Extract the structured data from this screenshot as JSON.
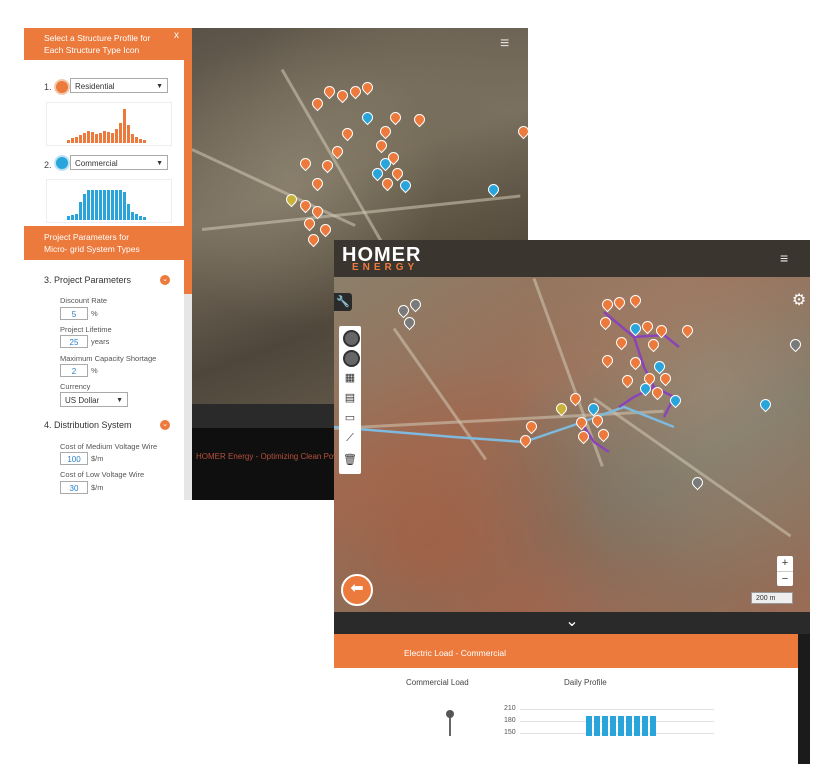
{
  "back_window": {
    "sidebar": {
      "header": "Select a Structure Profile for Each Structure Type Icon",
      "close_label": "x",
      "profiles": [
        {
          "number": "1.",
          "value": "Residential",
          "color": "#ec7a3c"
        },
        {
          "number": "2.",
          "value": "Commercial",
          "color": "#2aa5dc"
        }
      ],
      "project_header": "Project Parameters for Micro- grid System Types",
      "project_section": {
        "title": "3. Project Parameters",
        "fields": [
          {
            "label": "Discount Rate",
            "value": "5",
            "unit": "%"
          },
          {
            "label": "Project Lifetime",
            "value": "25",
            "unit": "years"
          },
          {
            "label": "Maximum Capacity Shortage",
            "value": "2",
            "unit": "%"
          }
        ],
        "currency_label": "Currency",
        "currency_value": "US Dollar"
      },
      "distribution_section": {
        "title": "4. Distribution System",
        "fields": [
          {
            "label": "Cost of Medium Voltage Wire",
            "value": "100",
            "unit": "$/m"
          },
          {
            "label": "Cost of Low Voltage Wire",
            "value": "30",
            "unit": "$/m"
          }
        ]
      }
    },
    "footer_text": "HOMER Energy - Optimizing Clean Power E",
    "expand_icon": "chevron-down-icon"
  },
  "front_window": {
    "logo_main": "HOMER",
    "logo_sub": "ENERGY",
    "scale_label": "200 m",
    "zoom_in": "+",
    "zoom_out": "−",
    "panel": {
      "title": "Electric Load - Commercial",
      "load_label": "Commercial Load",
      "profile_label": "Daily Profile",
      "y_ticks": [
        "210",
        "180",
        "150"
      ]
    }
  },
  "colors": {
    "accent": "#ec7a3c",
    "commercial": "#2aa5dc",
    "distribution_line": "#8a44b8"
  }
}
